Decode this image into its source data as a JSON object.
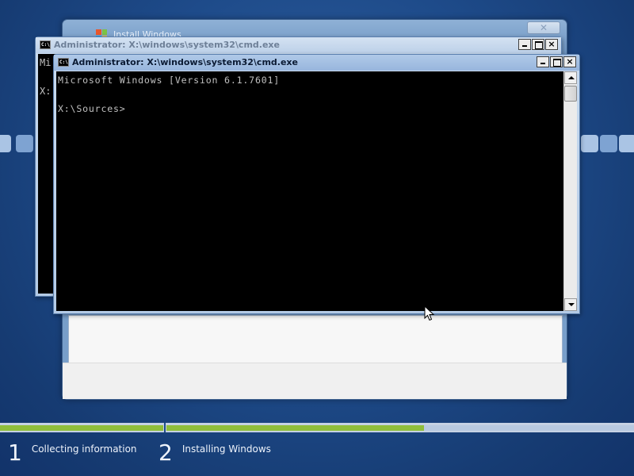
{
  "install_window": {
    "title": "Install Windows",
    "close_label": "✕"
  },
  "cmd_back": {
    "icon_text": "C:\\.",
    "title": "Administrator: X:\\windows\\system32\\cmd.exe",
    "lines": "Mi\n\nX:",
    "min_label": "",
    "max_label": "",
    "close_label": "×"
  },
  "cmd_front": {
    "icon_text": "C:\\.",
    "title": "Administrator: X:\\windows\\system32\\cmd.exe",
    "lines": "Microsoft Windows [Version 6.1.7601]\n\nX:\\Sources>",
    "close_label": "×"
  },
  "progress": {
    "step1_fraction": 1.0,
    "step2_fraction": 0.55,
    "colors": {
      "done": "#8fbe3b",
      "remaining": "#b8c9e0"
    }
  },
  "steps": [
    {
      "number": "1",
      "label": "Collecting information"
    },
    {
      "number": "2",
      "label": "Installing Windows"
    }
  ],
  "icons": [
    "windows-logo-icon",
    "cmd-icon",
    "minimize-icon",
    "maximize-icon",
    "close-icon",
    "scroll-up-icon",
    "scroll-down-icon",
    "mouse-cursor-icon"
  ]
}
